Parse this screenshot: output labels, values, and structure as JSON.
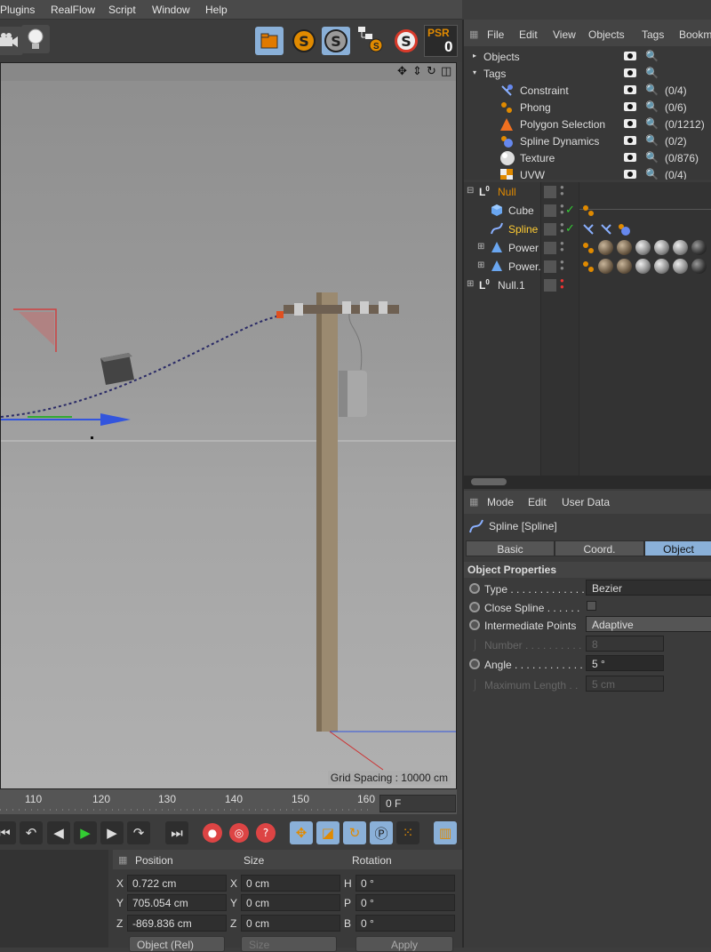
{
  "menubar": {
    "items": [
      "Plugins",
      "RealFlow",
      "Script",
      "Window",
      "Help"
    ]
  },
  "toolbar": {
    "psr_label": "PSR",
    "psr_value": "0"
  },
  "viewport": {
    "grid_spacing": "Grid Spacing : 10000 cm"
  },
  "timeline": {
    "ticks": [
      "110",
      "120",
      "130",
      "140",
      "150",
      "160"
    ],
    "frame": "0 F"
  },
  "objects_panel": {
    "menu": [
      "File",
      "Edit",
      "View",
      "Objects",
      "Tags",
      "Bookm"
    ],
    "tags_tree": {
      "root_objects": "Objects",
      "root_tags": "Tags",
      "items": [
        {
          "name": "Constraint",
          "count": "(0/4)",
          "icon": "constraint-tag-icon"
        },
        {
          "name": "Phong",
          "count": "(0/6)",
          "icon": "phong-tag-icon"
        },
        {
          "name": "Polygon Selection",
          "count": "(0/1212)",
          "icon": "polygon-selection-tag-icon"
        },
        {
          "name": "Spline Dynamics",
          "count": "(0/2)",
          "icon": "spline-dynamics-tag-icon"
        },
        {
          "name": "Texture",
          "count": "(0/876)",
          "icon": "texture-tag-icon"
        },
        {
          "name": "UVW",
          "count": "(0/4)",
          "icon": "uvw-tag-icon"
        }
      ]
    },
    "object_tree": [
      {
        "name": "Null",
        "selected": true
      },
      {
        "name": "Cube"
      },
      {
        "name": "Spline",
        "active": true
      },
      {
        "name": "Power"
      },
      {
        "name": "Power."
      },
      {
        "name": "Null.1"
      }
    ]
  },
  "attributes": {
    "menu": [
      "Mode",
      "Edit",
      "User Data"
    ],
    "title": "Spline [Spline]",
    "tabs": [
      "Basic",
      "Coord.",
      "Object"
    ],
    "active_tab": "Object",
    "section": "Object Properties",
    "props": [
      {
        "label": "Type . . . . . . . . . . . . . .",
        "value": "Bezier",
        "enabled": true
      },
      {
        "label": "Close Spline . . . . . .",
        "value": "",
        "enabled": true
      },
      {
        "label": "Intermediate Points",
        "value": "Adaptive",
        "enabled": true
      },
      {
        "label": "Number . . . . . . . . . .",
        "value": "8",
        "enabled": false
      },
      {
        "label": "Angle . . . . . . . . . . . .",
        "value": "5 °",
        "enabled": true
      },
      {
        "label": "Maximum Length . .",
        "value": "5 cm",
        "enabled": false
      }
    ]
  },
  "coordinates": {
    "headers": [
      "Position",
      "Size",
      "Rotation"
    ],
    "rows": [
      {
        "pl": "X",
        "p": "0.722 cm",
        "sl": "X",
        "s": "0 cm",
        "rl": "H",
        "r": "0 °"
      },
      {
        "pl": "Y",
        "p": "705.054 cm",
        "sl": "Y",
        "s": "0 cm",
        "rl": "P",
        "r": "0 °"
      },
      {
        "pl": "Z",
        "p": "-869.836 cm",
        "sl": "Z",
        "s": "0 cm",
        "rl": "B",
        "r": "0 °"
      }
    ],
    "mode_select": "Object (Rel)",
    "size_select": "Size",
    "apply": "Apply"
  }
}
